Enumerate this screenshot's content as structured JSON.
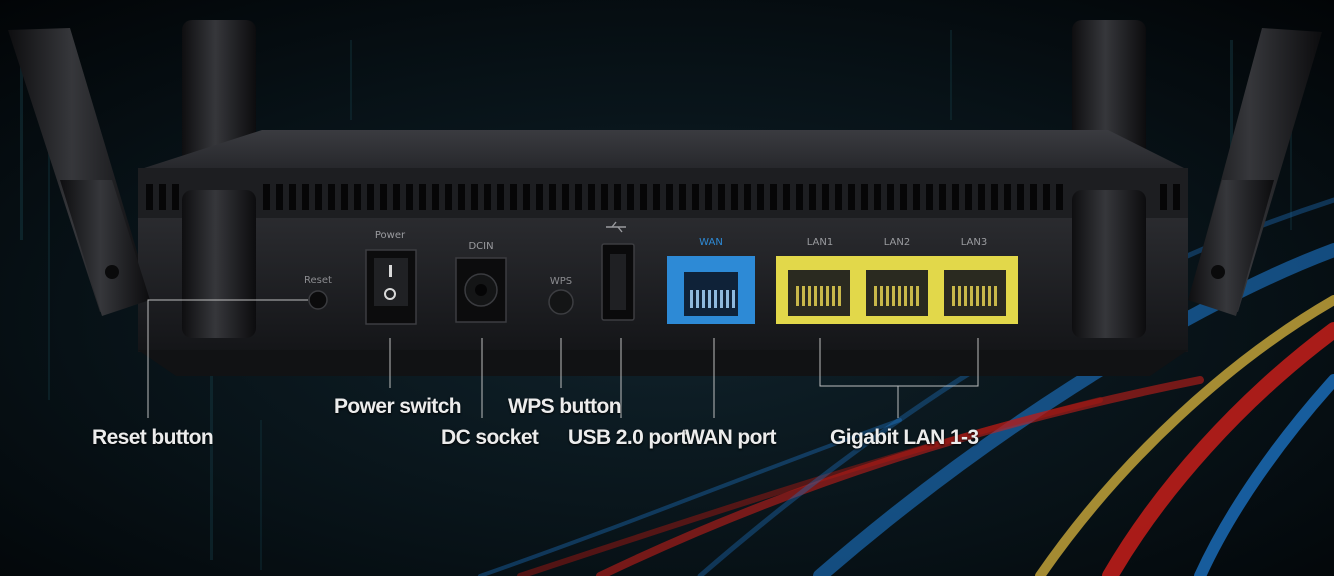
{
  "panel_labels": {
    "power": "Power",
    "dcin": "DCIN",
    "reset": "Reset",
    "wps": "WPS",
    "wan": "WAN",
    "lan1": "LAN1",
    "lan2": "LAN2",
    "lan3": "LAN3"
  },
  "callouts": {
    "reset": "Reset button",
    "power_switch": "Power switch",
    "dc_socket": "DC socket",
    "wps": "WPS button",
    "usb": "USB 2.0 port",
    "wan": "WAN port",
    "lan": "Gigabit LAN 1-3"
  },
  "colors": {
    "background": "#04080c",
    "router_body": "#1b1c1f",
    "wan_port": "#2d8ad6",
    "lan_block": "#e2d84a",
    "callout_text": "#ececec",
    "leader_line": "#cfcfcf",
    "light_streak_red": "#d21f1a",
    "light_streak_blue": "#1f7fd8",
    "light_streak_yellow": "#e8c040"
  }
}
